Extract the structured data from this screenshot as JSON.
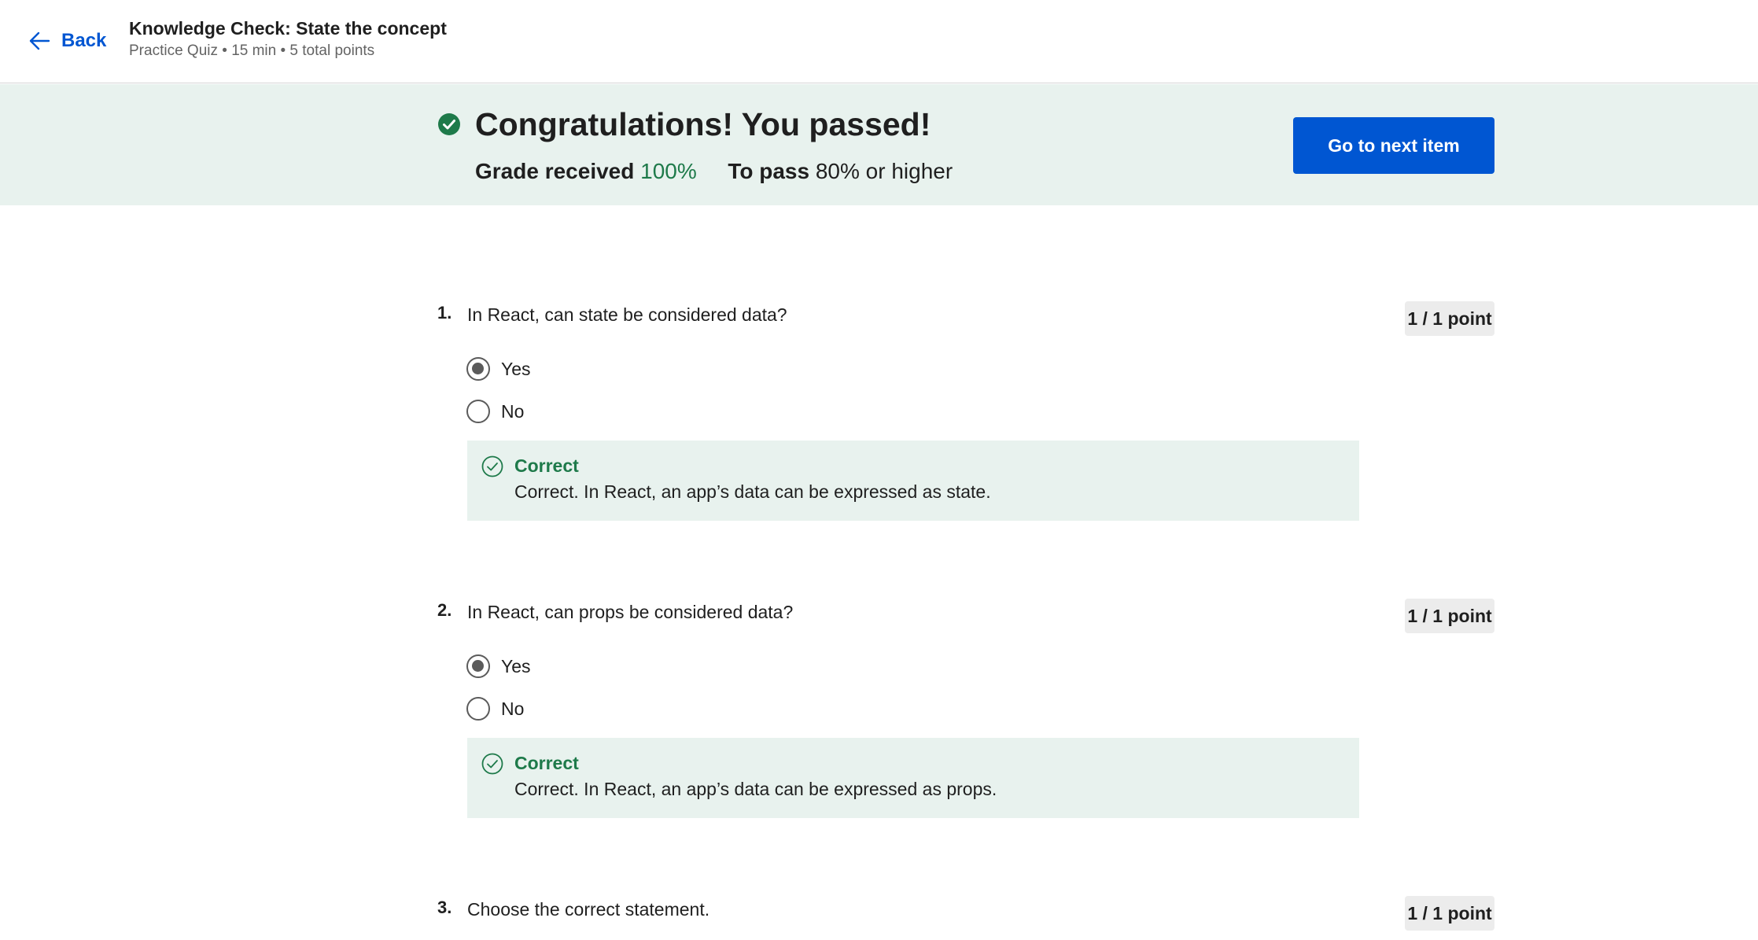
{
  "header": {
    "back_label": "Back",
    "title": "Knowledge Check: State the concept",
    "subtitle": "Practice Quiz • 15 min • 5 total points"
  },
  "banner": {
    "headline": "Congratulations! You passed!",
    "grade_label": "Grade received",
    "grade_value": "100%",
    "pass_label": "To pass",
    "pass_value": "80% or higher",
    "next_button_label": "Go to next item"
  },
  "questions": [
    {
      "number": "1.",
      "text": "In React, can state be considered data?",
      "points": "1 / 1 point",
      "options": [
        {
          "label": "Yes",
          "selected": true
        },
        {
          "label": "No",
          "selected": false
        }
      ],
      "feedback": {
        "title": "Correct",
        "text": "Correct. In React, an app’s data can be expressed as state."
      }
    },
    {
      "number": "2.",
      "text": "In React, can props be considered data?",
      "points": "1 / 1 point",
      "options": [
        {
          "label": "Yes",
          "selected": true
        },
        {
          "label": "No",
          "selected": false
        }
      ],
      "feedback": {
        "title": "Correct",
        "text": "Correct. In React, an app’s data can be expressed as props."
      }
    },
    {
      "number": "3.",
      "text": "Choose the correct statement.",
      "points": "1 / 1 point"
    }
  ],
  "colors": {
    "accent": "#0056d2",
    "success": "#1e7a4a",
    "success_bg": "#e8f2ee",
    "badge_bg": "#ececec"
  },
  "icons": {
    "back": "arrow-left-icon",
    "banner": "check-circle-filled-icon",
    "feedback": "check-circle-outline-icon"
  }
}
